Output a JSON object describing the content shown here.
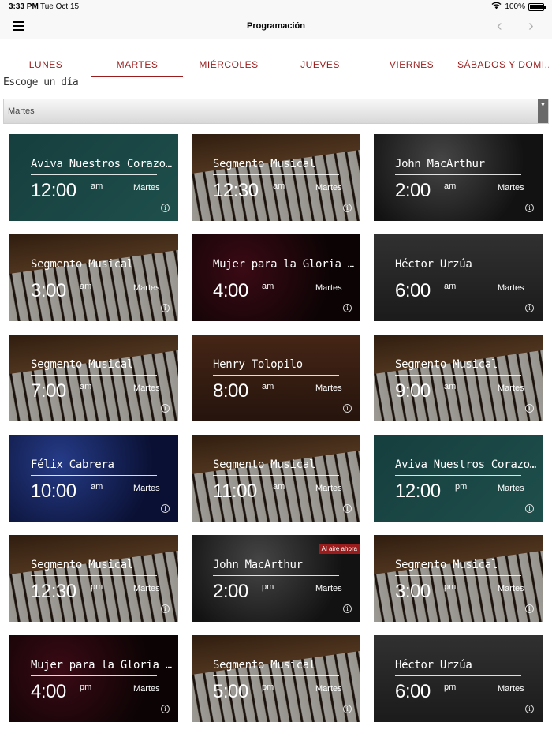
{
  "status": {
    "time": "3:33 PM",
    "date": "Tue Oct 15",
    "battery": "100%"
  },
  "nav": {
    "title": "Programación"
  },
  "tabs": [
    {
      "label": "LUNES"
    },
    {
      "label": "MARTES"
    },
    {
      "label": "MIÉRCOLES"
    },
    {
      "label": "JUEVES"
    },
    {
      "label": "VIERNES"
    },
    {
      "label": "SÁBADOS Y DOMI..."
    }
  ],
  "section": {
    "label": "Escoge un día"
  },
  "select": {
    "value": "Martes"
  },
  "live_label": "Al aire ahora",
  "cards": [
    {
      "title": "Aviva Nuestros Corazones",
      "time": "12:00",
      "ampm": "am",
      "day": "Martes",
      "bg": "aviva"
    },
    {
      "title": "Segmento Musical",
      "time": "12:30",
      "ampm": "am",
      "day": "Martes",
      "bg": "piano"
    },
    {
      "title": "John MacArthur",
      "time": "2:00",
      "ampm": "am",
      "day": "Martes",
      "bg": "john"
    },
    {
      "title": "Segmento Musical",
      "time": "3:00",
      "ampm": "am",
      "day": "Martes",
      "bg": "piano"
    },
    {
      "title": "Mujer para la Gloria de...",
      "time": "4:00",
      "ampm": "am",
      "day": "Martes",
      "bg": "mujer"
    },
    {
      "title": "Héctor Urzúa",
      "time": "6:00",
      "ampm": "am",
      "day": "Martes",
      "bg": "hector"
    },
    {
      "title": "Segmento Musical",
      "time": "7:00",
      "ampm": "am",
      "day": "Martes",
      "bg": "piano"
    },
    {
      "title": "Henry Tolopilo",
      "time": "8:00",
      "ampm": "am",
      "day": "Martes",
      "bg": "henry"
    },
    {
      "title": "Segmento Musical",
      "time": "9:00",
      "ampm": "am",
      "day": "Martes",
      "bg": "piano"
    },
    {
      "title": "Félix Cabrera",
      "time": "10:00",
      "ampm": "am",
      "day": "Martes",
      "bg": "felix"
    },
    {
      "title": "Segmento Musical",
      "time": "11:00",
      "ampm": "am",
      "day": "Martes",
      "bg": "piano"
    },
    {
      "title": "Aviva Nuestros Corazones",
      "time": "12:00",
      "ampm": "pm",
      "day": "Martes",
      "bg": "aviva"
    },
    {
      "title": "Segmento Musical",
      "time": "12:30",
      "ampm": "pm",
      "day": "Martes",
      "bg": "piano"
    },
    {
      "title": "John MacArthur",
      "time": "2:00",
      "ampm": "pm",
      "day": "Martes",
      "bg": "john",
      "live": true
    },
    {
      "title": "Segmento Musical",
      "time": "3:00",
      "ampm": "pm",
      "day": "Martes",
      "bg": "piano"
    },
    {
      "title": "Mujer para la Gloria de...",
      "time": "4:00",
      "ampm": "pm",
      "day": "Martes",
      "bg": "mujer"
    },
    {
      "title": "Segmento Musical",
      "time": "5:00",
      "ampm": "pm",
      "day": "Martes",
      "bg": "piano"
    },
    {
      "title": "Héctor Urzúa",
      "time": "6:00",
      "ampm": "pm",
      "day": "Martes",
      "bg": "hector"
    }
  ]
}
